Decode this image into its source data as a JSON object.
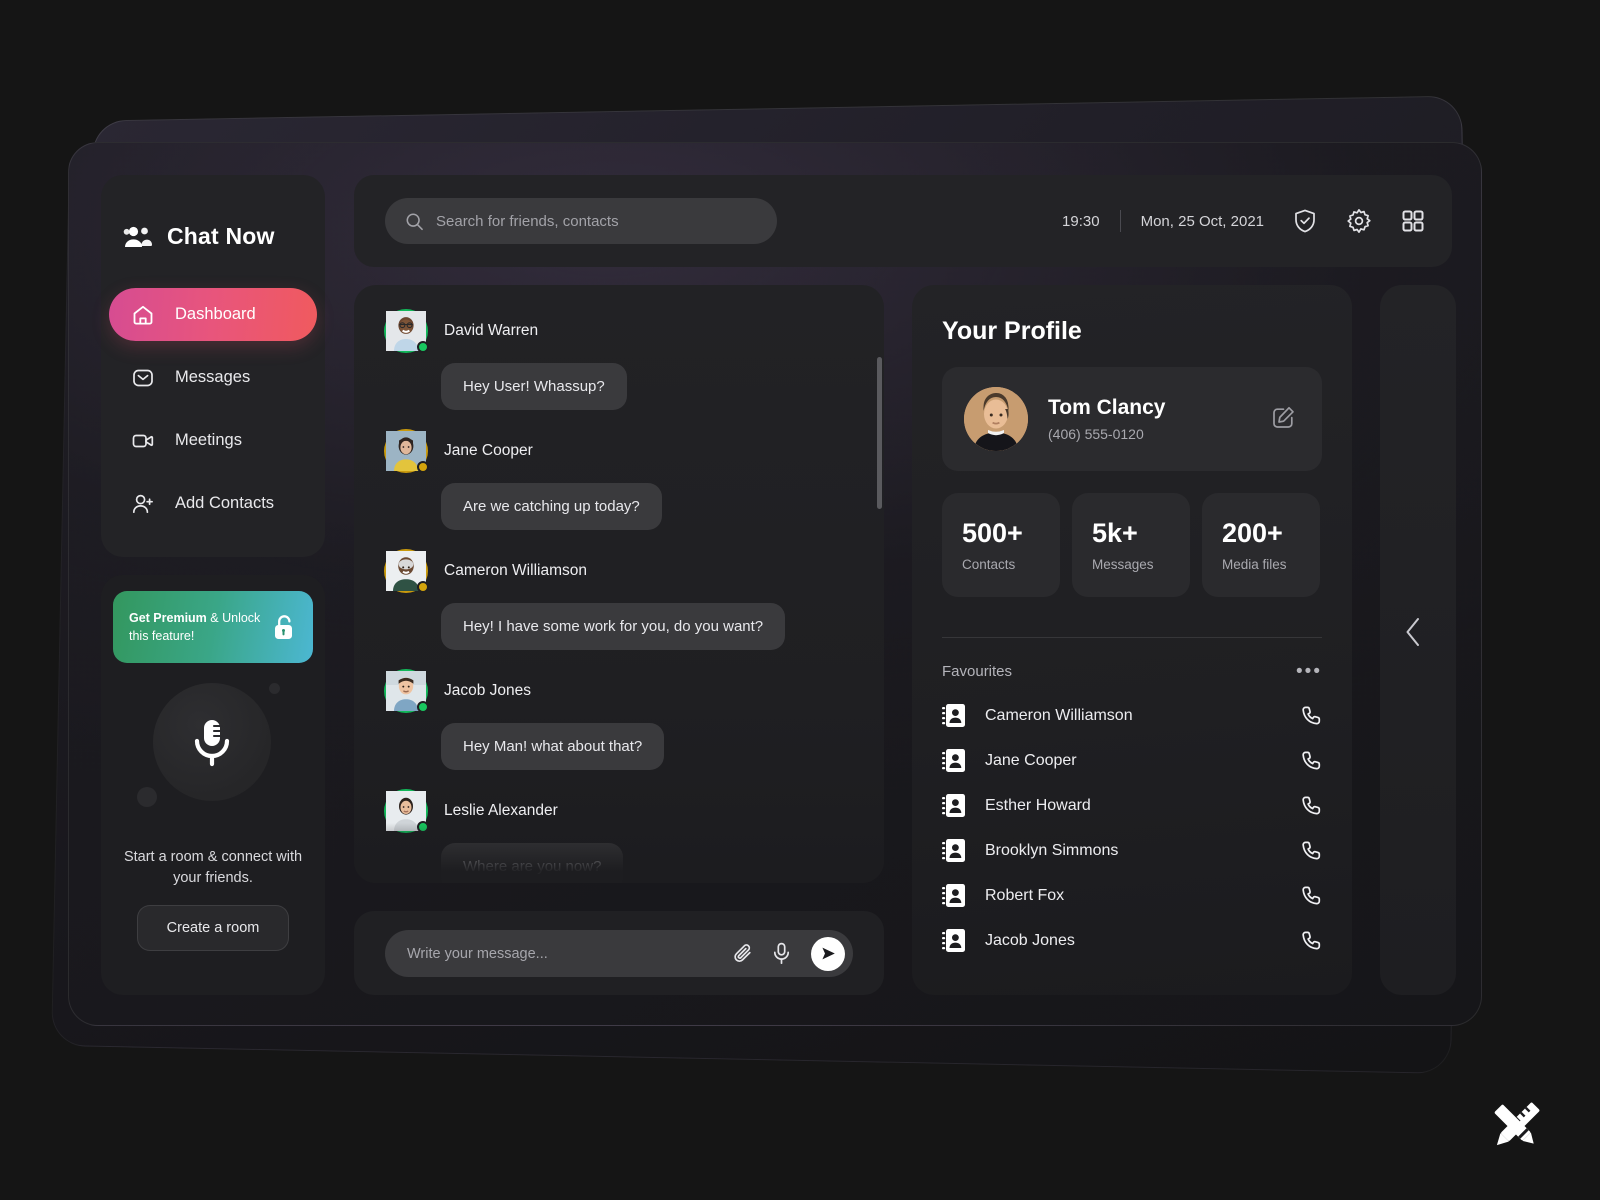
{
  "app": {
    "brand_title": "Chat Now",
    "logo_icon": "users-group-icon"
  },
  "sidebar": {
    "nav": [
      {
        "label": "Dashboard",
        "icon": "home-icon",
        "active": true
      },
      {
        "label": "Messages",
        "icon": "envelope-icon",
        "active": false
      },
      {
        "label": "Meetings",
        "icon": "video-camera-icon",
        "active": false
      },
      {
        "label": "Add Contacts",
        "icon": "user-plus-icon",
        "active": false
      }
    ],
    "premium": {
      "bold_text": "Get Premium",
      "rest_text": " & Unlock this feature!",
      "icon": "unlock-icon",
      "gradient_from": "#33975e",
      "gradient_to": "#4cb7d2"
    },
    "room": {
      "mic_icon": "microphone-icon",
      "caption": "Start a room & connect with your friends.",
      "button_label": "Create a room"
    },
    "active_accent_from": "#d64c92",
    "active_accent_to": "#f05a5e"
  },
  "topbar": {
    "search_placeholder": "Search for friends, contacts",
    "search_icon": "search-icon",
    "time": "19:30",
    "date": "Mon, 25 Oct, 2021",
    "icons": [
      "shield-check-icon",
      "gear-icon",
      "grid-apps-icon"
    ]
  },
  "chat": {
    "messages": [
      {
        "name": "David Warren",
        "text": "Hey User! Whassup?",
        "status": "online",
        "ring": "green"
      },
      {
        "name": "Jane Cooper",
        "text": "Are we catching up today?",
        "status": "away",
        "ring": "amber"
      },
      {
        "name": "Cameron Williamson",
        "text": "Hey! I have some work for you, do you want?",
        "status": "away",
        "ring": "amber"
      },
      {
        "name": "Jacob Jones",
        "text": "Hey Man! what about that?",
        "status": "online",
        "ring": "green"
      },
      {
        "name": "Leslie Alexander",
        "text": "Where are you now?",
        "status": "online",
        "ring": "green"
      }
    ]
  },
  "composer": {
    "placeholder": "Write your message...",
    "attach_icon": "paperclip-icon",
    "voice_icon": "microphone-icon",
    "send_icon": "send-icon"
  },
  "profile": {
    "title": "Your Profile",
    "name": "Tom Clancy",
    "phone": "(406) 555-0120",
    "edit_icon": "edit-pencil-icon",
    "stats": [
      {
        "value": "500+",
        "label": "Contacts"
      },
      {
        "value": "5k+",
        "label": "Messages"
      },
      {
        "value": "200+",
        "label": "Media files"
      }
    ],
    "favourites": {
      "title": "Favourites",
      "more_label": "•••",
      "items": [
        {
          "name": "Cameron Williamson",
          "icon": "contact-card-icon",
          "action_icon": "phone-icon"
        },
        {
          "name": "Jane Cooper",
          "icon": "contact-card-icon",
          "action_icon": "phone-icon"
        },
        {
          "name": "Esther Howard",
          "icon": "contact-card-icon",
          "action_icon": "phone-icon"
        },
        {
          "name": "Brooklyn Simmons",
          "icon": "contact-card-icon",
          "action_icon": "phone-icon"
        },
        {
          "name": "Robert Fox",
          "icon": "contact-card-icon",
          "action_icon": "phone-icon"
        },
        {
          "name": "Jacob Jones",
          "icon": "contact-card-icon",
          "action_icon": "phone-icon"
        }
      ]
    }
  },
  "peek_panel": {
    "collapse_icon": "chevron-left-icon"
  },
  "watermark": {
    "icon": "pencil-ruler-cross-icon"
  }
}
